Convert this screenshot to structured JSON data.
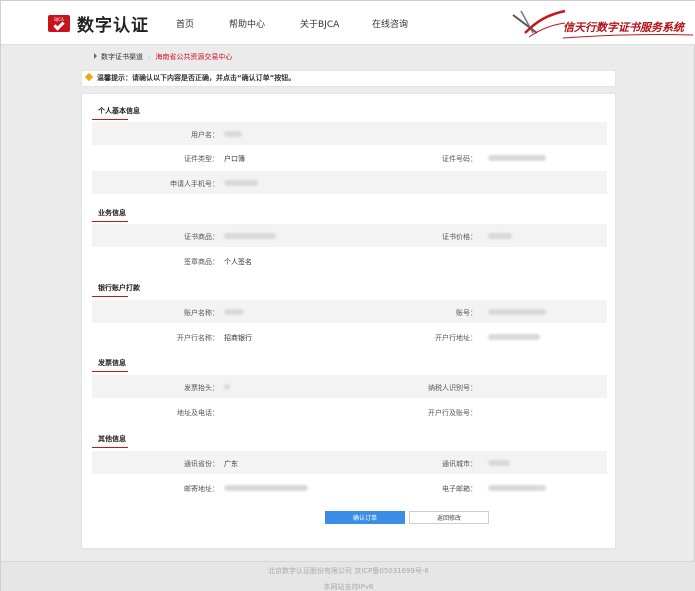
{
  "header": {
    "logo_text": "数字认证",
    "logo_badge": "BJCA",
    "nav": [
      "首页",
      "帮助中心",
      "关于BJCA",
      "在线咨询"
    ],
    "brand_slogan": "信天行数字证书服务系统"
  },
  "breadcrumb": {
    "label": "数字证书渠道",
    "separator": ":",
    "current": "海南省公共资源交易中心"
  },
  "tip": {
    "prefix": "温馨提示：",
    "text": "请确认以下内容是否正确，并点击“确认订单”按钮。"
  },
  "sections": {
    "personal": {
      "title": "个人基本信息",
      "username_label": "用户名：",
      "cert_type_label": "证件类型：",
      "cert_type_value": "户口簿",
      "cert_no_label": "证件号码：",
      "phone_label": "申请人手机号："
    },
    "business": {
      "title": "业务信息",
      "product_label": "证书商品：",
      "price_label": "证书价格：",
      "seal_label": "签章商品：",
      "seal_value": "个人签名"
    },
    "bank": {
      "title": "银行账户打款",
      "account_name_label": "账户名称：",
      "account_no_label": "账号：",
      "bank_name_label": "开户行名称：",
      "bank_name_value": "招商银行",
      "bank_addr_label": "开户行地址："
    },
    "invoice": {
      "title": "发票信息",
      "invoice_title_label": "发票抬头：",
      "tax_id_label": "纳税人识别号：",
      "address_phone_label": "地址及电话：",
      "bank_account_label": "开户行及账号："
    },
    "other": {
      "title": "其他信息",
      "province_label": "通讯省份：",
      "province_value": "广东",
      "city_label": "通讯城市：",
      "postal_addr_label": "邮寄地址：",
      "email_label": "电子邮箱："
    }
  },
  "buttons": {
    "confirm": "确认订单",
    "back": "返回修改"
  },
  "footer": {
    "line1": "北京数字认证股份有限公司 京ICP备05031699号-6",
    "line2": "本网站支持IPv6"
  },
  "colors": {
    "brand_red": "#c8151d",
    "primary_blue": "#3a8ee6",
    "tip_orange": "#f3a31b"
  }
}
